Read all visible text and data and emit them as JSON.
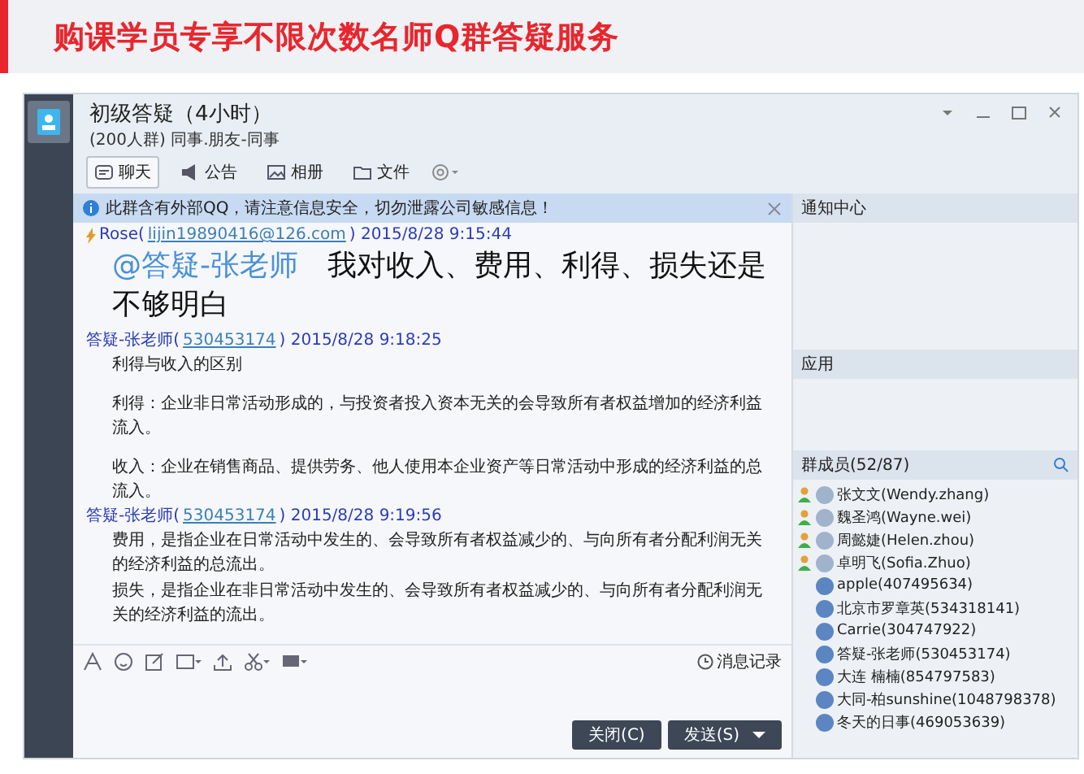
{
  "banner": {
    "title": "购课学员专享不限次数名师Q群答疑服务"
  },
  "window": {
    "title": "初级答疑（4小时）",
    "subtitle": "(200人群) 同事.朋友-同事"
  },
  "tabs": [
    {
      "label": "聊天",
      "selected": true
    },
    {
      "label": "公告",
      "selected": false
    },
    {
      "label": "相册",
      "selected": false
    },
    {
      "label": "文件",
      "selected": false
    }
  ],
  "notice": "此群含有外部QQ，请注意信息安全，切勿泄露公司敏感信息！",
  "messages": [
    {
      "kind": "big",
      "name": "Rose(",
      "link": "lijin19890416@126.com",
      "after": ") 2015/8/28 9:15:44",
      "mention": "@答疑-张老师",
      "text": "我对收入、费用、利得、损失还是不够明白"
    },
    {
      "kind": "normal",
      "name": "答疑-张老师(",
      "link": "530453174",
      "after": ") 2015/8/28 9:18:25",
      "blocks": [
        [
          "利得与收入的区别"
        ],
        [
          "利得：企业非日常活动形成的，与投资者投入资本无关的会导致所有者权益增加的经济利益流入。"
        ],
        [
          "收入：企业在销售商品、提供劳务、他人使用本企业资产等日常活动中形成的经济利益的总流入。"
        ]
      ]
    },
    {
      "kind": "normal",
      "name": "答疑-张老师(",
      "link": "530453174",
      "after": ") 2015/8/28 9:19:56",
      "blocks": [
        [
          "费用，是指企业在日常活动中发生的、会导致所有者权益减少的、与向所有者分配利润无关的经济利益的总流出。",
          "损失，是指企业在非日常活动中发生的、会导致所有者权益减少的、与向所有者分配利润无关的经济利益的流出。"
        ]
      ]
    }
  ],
  "history": "消息记录",
  "buttons": {
    "close": "关闭(C)",
    "send": "发送(S)"
  },
  "panel": {
    "notifications": "通知中心",
    "apps": "应用",
    "members_title": "群成员(52/87)"
  },
  "members": [
    {
      "name": "张文文(Wendy.zhang)",
      "kind": "admin"
    },
    {
      "name": "魏圣鸿(Wayne.wei)",
      "kind": "admin"
    },
    {
      "name": "周懿婕(Helen.zhou)",
      "kind": "admin"
    },
    {
      "name": "卓明飞(Sofia.Zhuo)",
      "kind": "admin"
    },
    {
      "name": "apple(407495634)",
      "kind": "member"
    },
    {
      "name": "北京市罗章英(534318141)",
      "kind": "member"
    },
    {
      "name": "Carrie(304747922)",
      "kind": "member"
    },
    {
      "name": "答疑-张老师(530453174)",
      "kind": "member"
    },
    {
      "name": "大连 楠楠(854797583)",
      "kind": "member"
    },
    {
      "name": "大同-柏sunshine(1048798378)",
      "kind": "member"
    },
    {
      "name": "冬天的日事(469053639)",
      "kind": "member"
    }
  ]
}
